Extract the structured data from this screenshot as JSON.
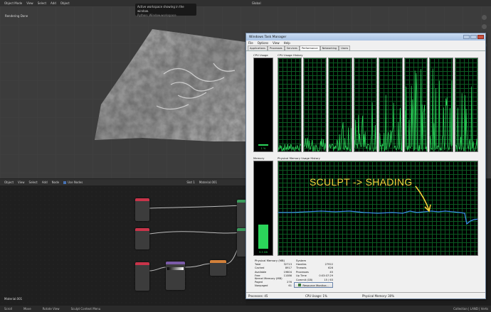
{
  "blender": {
    "header_items": [
      "Object Mode",
      "View",
      "Select",
      "Add",
      "Object"
    ],
    "orientation": "Global",
    "status_text": "Rendering Done",
    "tooltip": {
      "title": "Active workspace showing in the window.",
      "python": "Python: Window.workspace"
    },
    "node_header": {
      "editor": "Object",
      "menu": [
        "View",
        "Select",
        "Add",
        "Node"
      ],
      "use_nodes": "Use Nodes",
      "slot": "Slot 1",
      "material": "Material.001"
    },
    "material_label": "Material.001",
    "statusbar": {
      "items": [
        "Scroll",
        "Move",
        "Rotate View",
        "Sculpt Context Menu"
      ],
      "right": "Collection | LAND | Verts"
    }
  },
  "task_manager": {
    "title": "Windows Task Manager",
    "menu": [
      "File",
      "Options",
      "View",
      "Help"
    ],
    "tabs": [
      "Applications",
      "Processes",
      "Services",
      "Performance",
      "Networking",
      "Users"
    ],
    "active_tab": "Performance",
    "labels": {
      "cpu_usage": "CPU Usage",
      "cpu_history": "CPU Usage History",
      "memory": "Memory",
      "mem_history": "Physical Memory Usage History"
    },
    "cpu_percent_text": "1 %",
    "memory_text": "9.5 GB",
    "cpu_levels": [
      0.08,
      0.15,
      0.35,
      0.55,
      0.65,
      0.9,
      0.98,
      0.75
    ],
    "memory_level": 0.3,
    "physical_memory": {
      "heading": "Physical Memory (MB)",
      "rows": [
        {
          "k": "Total",
          "v": "32713"
        },
        {
          "k": "Cached",
          "v": "8917"
        },
        {
          "k": "Available",
          "v": "19604"
        },
        {
          "k": "Free",
          "v": "11086"
        }
      ]
    },
    "kernel_memory": {
      "heading": "Kernel Memory (MB)",
      "rows": [
        {
          "k": "Paged",
          "v": "276"
        },
        {
          "k": "Nonpaged",
          "v": "61"
        }
      ]
    },
    "system": {
      "heading": "System",
      "rows": [
        {
          "k": "Handles",
          "v": "27922"
        },
        {
          "k": "Threads",
          "v": "626"
        },
        {
          "k": "Processes",
          "v": "45"
        },
        {
          "k": "Up Time",
          "v": "0:03:07:29"
        },
        {
          "k": "Commit (GB)",
          "v": "15 / 63"
        }
      ]
    },
    "resource_monitor_button": "Resource Monitor...",
    "status": {
      "processes": "Processes: 45",
      "cpu": "CPU Usage: 1%",
      "memory": "Physical Memory: 30%"
    }
  },
  "annotation": "SCULPT -> SHADING",
  "colors": {
    "graph_green": "#2bd45a",
    "memory_line": "#3a8ee6",
    "annotation": "#f4d23c"
  }
}
